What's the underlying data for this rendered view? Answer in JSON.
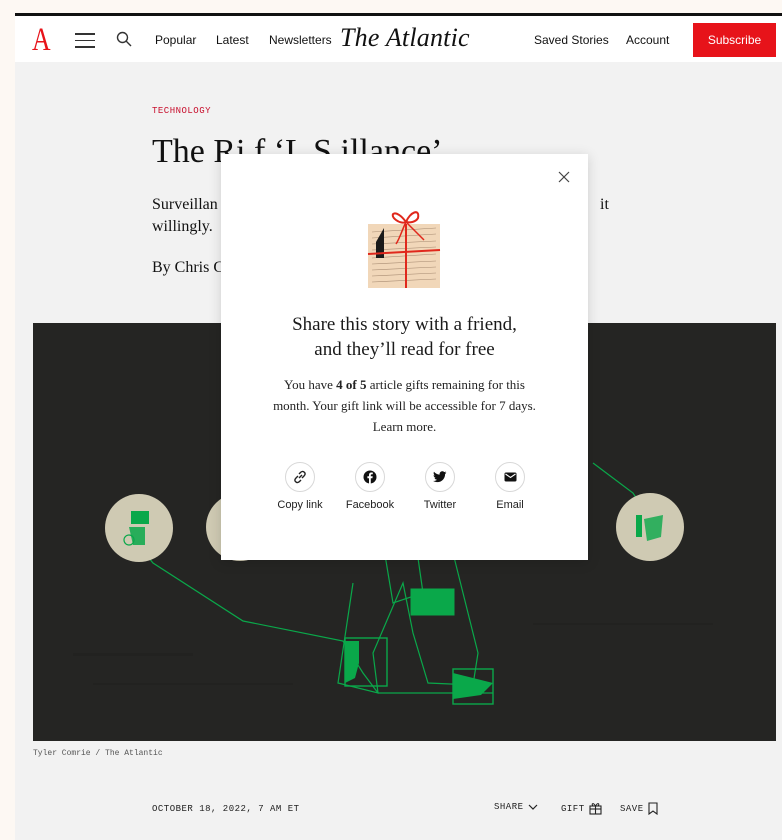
{
  "header": {
    "logo": "A",
    "nav": [
      "Popular",
      "Latest",
      "Newsletters"
    ],
    "masthead": "The Atlantic",
    "saved_stories": "Saved Stories",
    "account": "Account",
    "subscribe": "Subscribe"
  },
  "article": {
    "section": "TECHNOLOGY",
    "headline_visible": "The Ri          f ‘L          S         illance’",
    "dek_line1": "Surveillan",
    "dek_line1_tail": "it",
    "dek_line2": "willingly.",
    "byline": "By Chris C",
    "caption": "Tyler Comrie / The Atlantic",
    "date": "OCTOBER 18, 2022, 7 AM ET",
    "share_label": "SHARE",
    "gift_label": "GIFT",
    "save_label": "SAVE"
  },
  "gift_modal": {
    "title_line1": "Share this story with a friend,",
    "title_line2": "and they’ll read for free",
    "body_prefix": "You have ",
    "body_count": "4 of 5",
    "body_suffix": " article gifts remaining for this month. Your gift link will be accessible for 7 days. Learn more.",
    "share_options": [
      {
        "label": "Copy link",
        "icon": "link-icon"
      },
      {
        "label": "Facebook",
        "icon": "facebook-icon"
      },
      {
        "label": "Twitter",
        "icon": "twitter-icon"
      },
      {
        "label": "Email",
        "icon": "email-icon"
      }
    ]
  },
  "colors": {
    "brand_red": "#e7131a",
    "accent_green": "#0aa84a",
    "art_bg": "#252523"
  }
}
